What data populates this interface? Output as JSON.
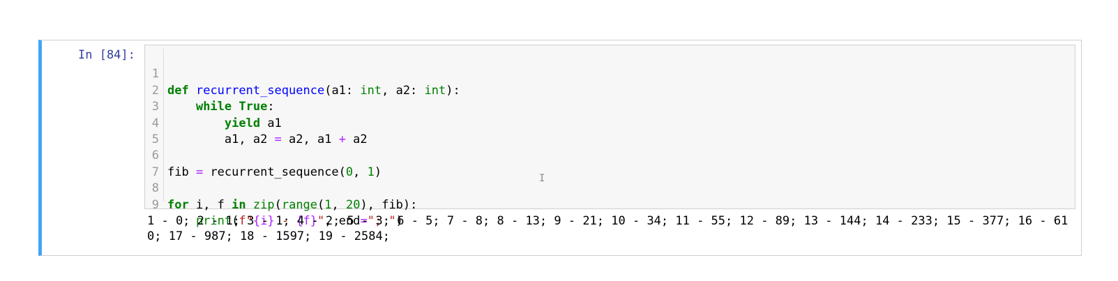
{
  "cell": {
    "prompt": "In [84]:",
    "lines": [
      {
        "n": "1"
      },
      {
        "n": "2"
      },
      {
        "n": "3"
      },
      {
        "n": "4"
      },
      {
        "n": "5"
      },
      {
        "n": "6"
      },
      {
        "n": "7"
      },
      {
        "n": "8"
      },
      {
        "n": "9"
      }
    ],
    "code": {
      "l1": {
        "kw": "def",
        "name": "recurrent_sequence",
        "p1": "(a1: ",
        "t1": "int",
        "p2": ", a2: ",
        "t2": "int",
        "p3": "):"
      },
      "l2": {
        "kw1": "while",
        "kw2": "True",
        "rest": ":"
      },
      "l3": {
        "kw": "yield",
        "rest": " a1"
      },
      "l4": {
        "a": "a1, a2 ",
        "op1": "=",
        "b": " a2, a1 ",
        "op2": "+",
        "c": " a2"
      },
      "l6": {
        "a": "fib ",
        "op": "=",
        "b": " recurrent_sequence(",
        "n1": "0",
        "c": ", ",
        "n2": "1",
        "d": ")"
      },
      "l8": {
        "kw1": "for",
        "a": " i, f ",
        "kw2": "in",
        "sp": " ",
        "b1": "zip",
        "p1": "(",
        "b2": "range",
        "p2": "(",
        "n1": "1",
        "c": ", ",
        "n2": "20",
        "d": "), fib):"
      },
      "l9": {
        "b": "print",
        "p1": "(",
        "s1": "f\"",
        "i1": "{i}",
        "s2": " - ",
        "i2": "{f}",
        "s3": "\"",
        "c": ", end",
        "op": "=",
        "s4": "\"; \"",
        "d": ")"
      }
    },
    "output": "1 - 0; 2 - 1; 3 - 1; 4 - 2; 5 - 3; 6 - 5; 7 - 8; 8 - 13; 9 - 21; 10 - 34; 11 - 55; 12 - 89; 13 - 144; 14 - 233; 15 - 377; 16 - 610; 17 - 987; 18 - 1597; 19 - 2584;"
  }
}
